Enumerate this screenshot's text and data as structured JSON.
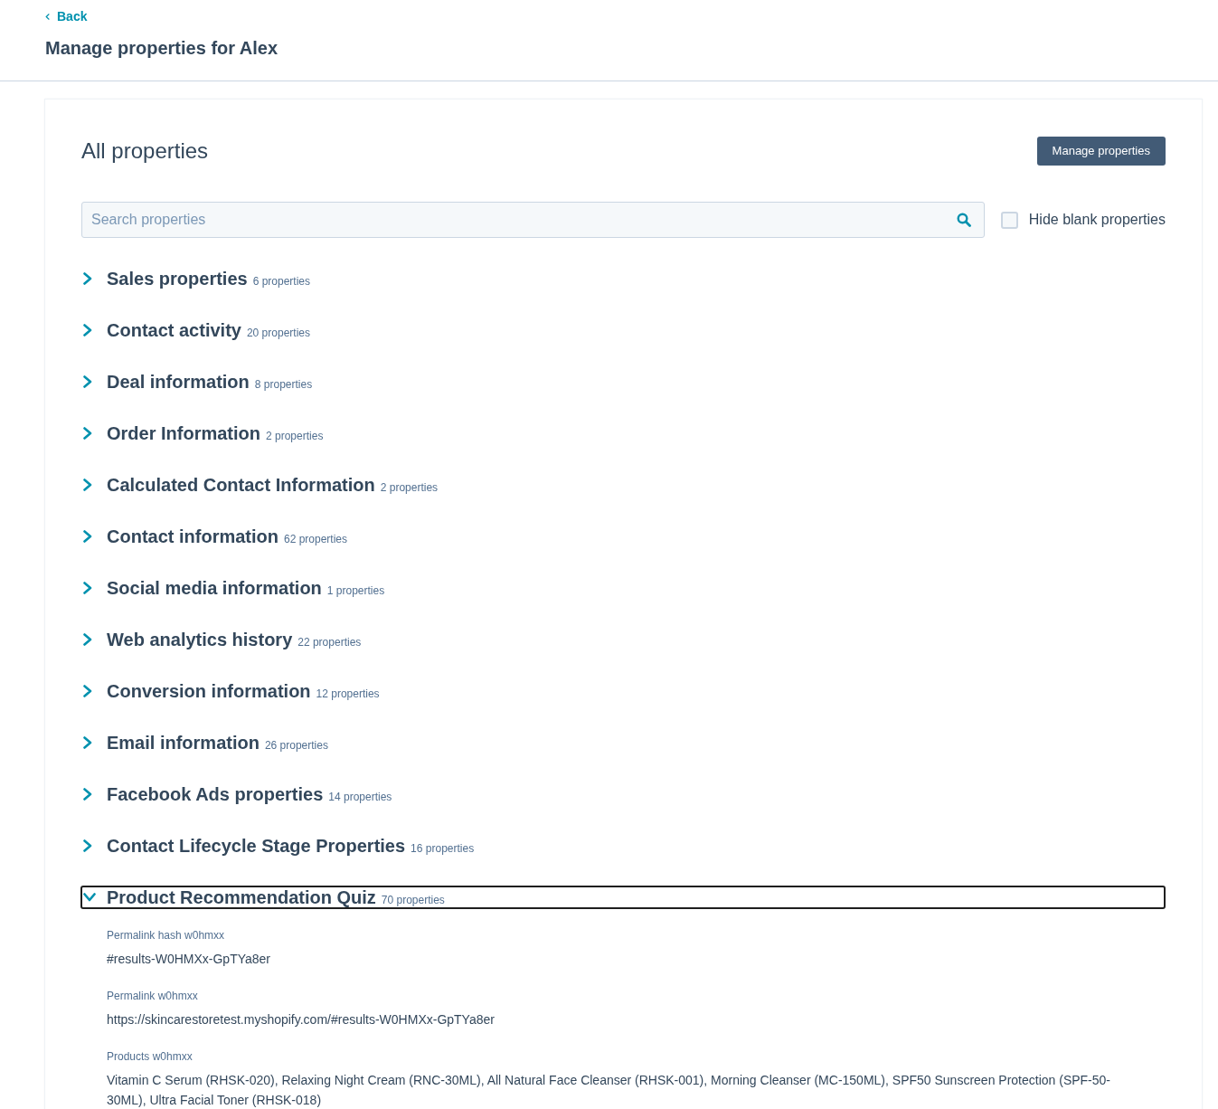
{
  "header": {
    "back_link": "Back",
    "title": "Manage properties for Alex"
  },
  "card": {
    "title": "All properties",
    "manage_button": "Manage properties",
    "search": {
      "placeholder": "Search properties"
    },
    "hide_blank": {
      "label": "Hide blank properties",
      "checked": false
    },
    "groups": [
      {
        "title": "Sales properties",
        "count": "6 properties",
        "expanded": false,
        "focused": false
      },
      {
        "title": "Contact activity",
        "count": "20 properties",
        "expanded": false,
        "focused": false
      },
      {
        "title": "Deal information",
        "count": "8 properties",
        "expanded": false,
        "focused": false
      },
      {
        "title": "Order Information",
        "count": "2 properties",
        "expanded": false,
        "focused": false
      },
      {
        "title": "Calculated Contact Information",
        "count": "2 properties",
        "expanded": false,
        "focused": false
      },
      {
        "title": "Contact information",
        "count": "62 properties",
        "expanded": false,
        "focused": false
      },
      {
        "title": "Social media information",
        "count": "1 properties",
        "expanded": false,
        "focused": false
      },
      {
        "title": "Web analytics history",
        "count": "22 properties",
        "expanded": false,
        "focused": false
      },
      {
        "title": "Conversion information",
        "count": "12 properties",
        "expanded": false,
        "focused": false
      },
      {
        "title": "Email information",
        "count": "26 properties",
        "expanded": false,
        "focused": false
      },
      {
        "title": "Facebook Ads properties",
        "count": "14 properties",
        "expanded": false,
        "focused": false
      },
      {
        "title": "Contact Lifecycle Stage Properties",
        "count": "16 properties",
        "expanded": false,
        "focused": false
      },
      {
        "title": "Product Recommendation Quiz",
        "count": "70 properties",
        "expanded": true,
        "focused": true,
        "properties": [
          {
            "label": "Permalink hash w0hmxx",
            "value": "#results-W0HMXx-GpTYa8er"
          },
          {
            "label": "Permalink w0hmxx",
            "value": "https://skincarestoretest.myshopify.com/#results-W0HMXx-GpTYa8er"
          },
          {
            "label": "Products w0hmxx",
            "value": "Vitamin C Serum (RHSK-020), Relaxing Night Cream (RNC-30ML), All Natural Face Cleanser (RHSK-001), Morning Cleanser (MC-150ML), SPF50 Sunscreen Protection (SPF-50-30ML), Ultra Facial Toner (RHSK-018)"
          }
        ]
      }
    ]
  }
}
